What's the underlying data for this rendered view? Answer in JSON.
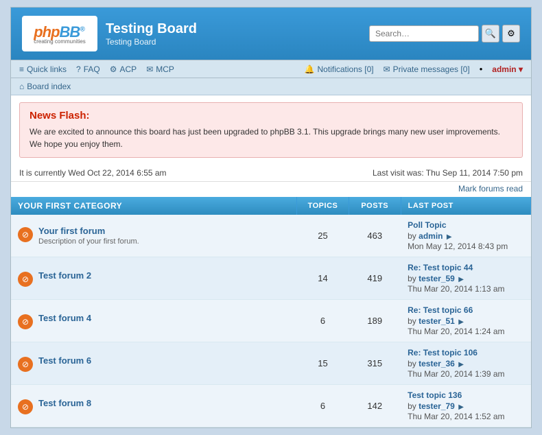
{
  "header": {
    "logo_text": "phpBB",
    "logo_sub": "creating communities",
    "board_title": "Testing Board",
    "board_subtitle": "Testing Board",
    "search_placeholder": "Search…"
  },
  "navbar": {
    "quick_links": "Quick links",
    "faq": "FAQ",
    "acp": "ACP",
    "mcp": "MCP",
    "notifications": "Notifications",
    "notifications_count": "0",
    "private_messages": "Private messages",
    "pm_count": "0",
    "admin": "admin"
  },
  "breadcrumb": {
    "board_index": "Board index"
  },
  "news_flash": {
    "title": "News Flash:",
    "body": "We are excited to announce this board has just been upgraded to phpBB 3.1. This upgrade brings many new user improvements. We hope you enjoy them."
  },
  "status": {
    "current_time": "It is currently Wed Oct 22, 2014 6:55 am",
    "last_visit": "Last visit was: Thu Sep 11, 2014 7:50 pm",
    "mark_read": "Mark forums read"
  },
  "category": {
    "header": "YOUR FIRST CATEGORY",
    "col_topics": "TOPICS",
    "col_posts": "POSTS",
    "col_last_post": "LAST POST"
  },
  "forums": [
    {
      "name": "Your first forum",
      "description": "Description of your first forum.",
      "topics": "25",
      "posts": "463",
      "last_post_title": "Poll Topic",
      "last_post_by": "admin",
      "last_post_time": "Mon May 12, 2014 8:43 pm"
    },
    {
      "name": "Test forum 2",
      "description": "",
      "topics": "14",
      "posts": "419",
      "last_post_title": "Re: Test topic 44",
      "last_post_by": "tester_59",
      "last_post_time": "Thu Mar 20, 2014 1:13 am"
    },
    {
      "name": "Test forum 4",
      "description": "",
      "topics": "6",
      "posts": "189",
      "last_post_title": "Re: Test topic 66",
      "last_post_by": "tester_51",
      "last_post_time": "Thu Mar 20, 2014 1:24 am"
    },
    {
      "name": "Test forum 6",
      "description": "",
      "topics": "15",
      "posts": "315",
      "last_post_title": "Re: Test topic 106",
      "last_post_by": "tester_36",
      "last_post_time": "Thu Mar 20, 2014 1:39 am"
    },
    {
      "name": "Test forum 8",
      "description": "",
      "topics": "6",
      "posts": "142",
      "last_post_title": "Test topic 136",
      "last_post_by": "tester_79",
      "last_post_time": "Thu Mar 20, 2014 1:52 am"
    }
  ]
}
